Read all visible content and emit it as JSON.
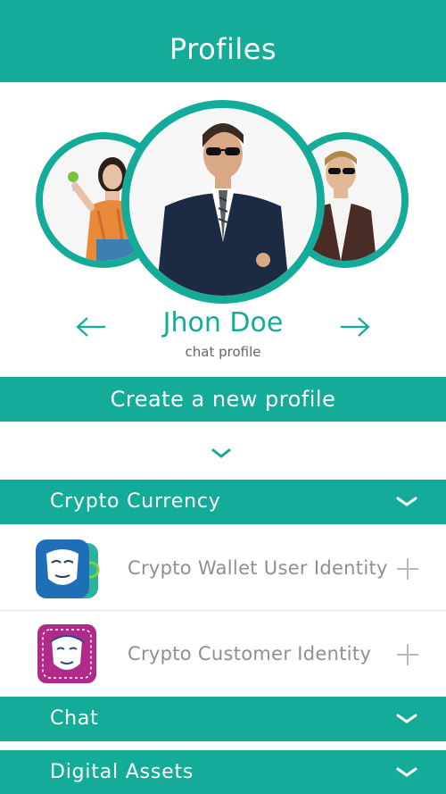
{
  "header": {
    "title": "Profiles"
  },
  "profile": {
    "name": "Jhon Doe",
    "subtitle": "chat profile",
    "avatars": [
      "woman-avatar",
      "man-suit-avatar",
      "man-jacket-avatar"
    ]
  },
  "actions": {
    "create_label": "Create a new profile"
  },
  "sections": {
    "crypto": {
      "label": "Crypto Currency",
      "items": [
        {
          "label": "Crypto Wallet User Identity",
          "icon": "mask-wallet-icon"
        },
        {
          "label": "Crypto Customer Identity",
          "icon": "mask-customer-icon"
        }
      ]
    },
    "chat": {
      "label": "Chat"
    },
    "digital": {
      "label": "Digital Assets"
    }
  },
  "colors": {
    "accent": "#14ab98",
    "text_muted": "#8f8f8f",
    "white": "#ffffff"
  }
}
